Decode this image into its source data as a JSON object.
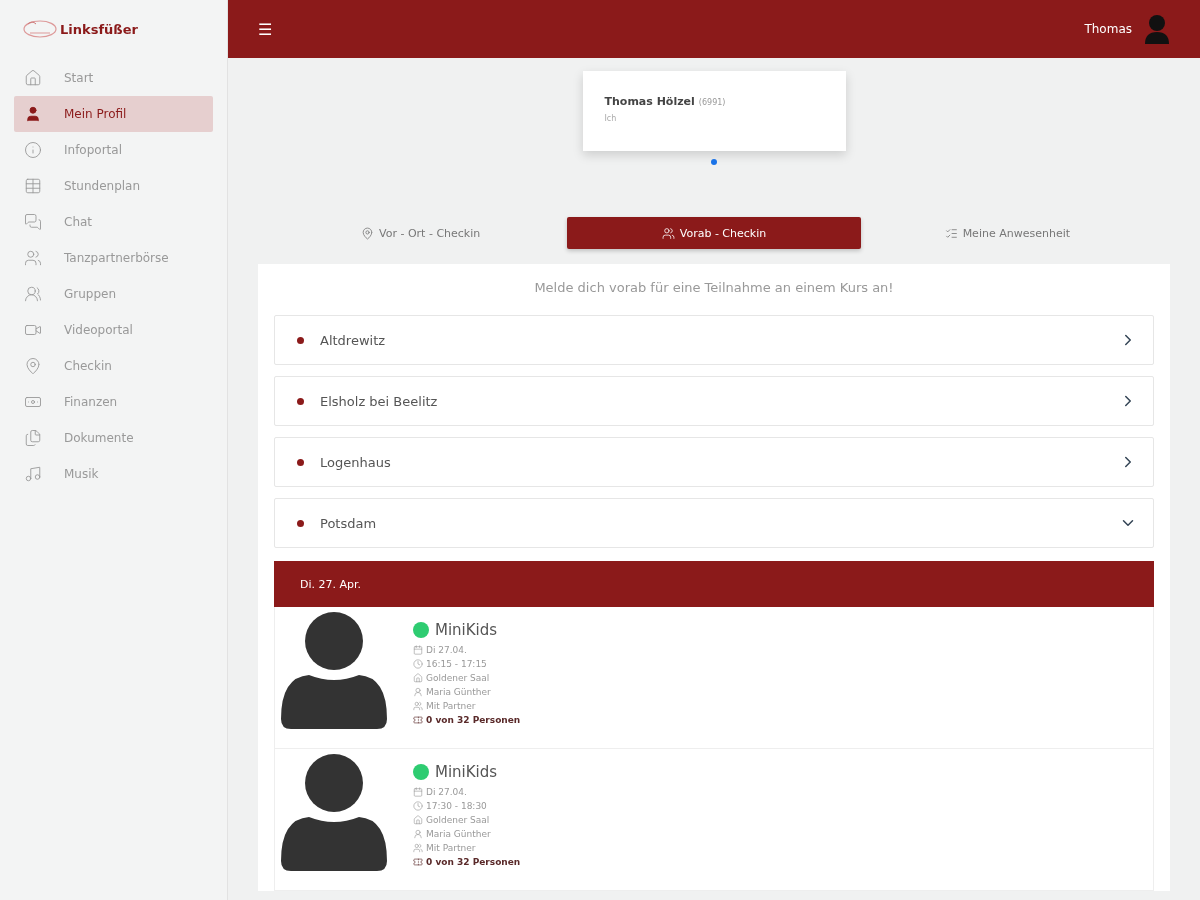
{
  "brand": {
    "name": "Linksfüßer"
  },
  "sidebar": {
    "items": [
      {
        "label": "Start",
        "selected": false
      },
      {
        "label": "Mein Profil",
        "selected": true
      },
      {
        "label": "Infoportal",
        "selected": false
      },
      {
        "label": "Stundenplan",
        "selected": false
      },
      {
        "label": "Chat",
        "selected": false
      },
      {
        "label": "Tanzpartnerbörse",
        "selected": false
      },
      {
        "label": "Gruppen",
        "selected": false
      },
      {
        "label": "Videoportal",
        "selected": false
      },
      {
        "label": "Checkin",
        "selected": false
      },
      {
        "label": "Finanzen",
        "selected": false
      },
      {
        "label": "Dokumente",
        "selected": false
      },
      {
        "label": "Musik",
        "selected": false
      }
    ]
  },
  "header": {
    "menu_glyph": "☰",
    "user_name": "Thomas"
  },
  "profile_card": {
    "name": "Thomas Hölzel",
    "id": "(6991)",
    "role": "Ich"
  },
  "tabs": [
    {
      "label": "Vor - Ort - Checkin",
      "selected": false
    },
    {
      "label": "Vorab - Checkin",
      "selected": true
    },
    {
      "label": "Meine Anwesenheit",
      "selected": false
    }
  ],
  "panel": {
    "intro": "Melde dich vorab für eine Teilnahme an einem Kurs an!",
    "locations": [
      {
        "name": "Altdrewitz",
        "expanded": false
      },
      {
        "name": "Elsholz bei Beelitz",
        "expanded": false
      },
      {
        "name": "Logenhaus",
        "expanded": false
      },
      {
        "name": "Potsdam",
        "expanded": true
      }
    ],
    "day_header": "Di. 27. Apr.",
    "courses": [
      {
        "title": "MiniKids",
        "color": "#2ecc71",
        "details": [
          {
            "kind": "date",
            "text": "Di 27.04."
          },
          {
            "kind": "time",
            "text": "16:15 - 17:15"
          },
          {
            "kind": "room",
            "text": "Goldener Saal"
          },
          {
            "kind": "teacher",
            "text": "Maria Günther"
          },
          {
            "kind": "partner",
            "text": "Mit Partner"
          },
          {
            "kind": "capacity",
            "text": "0 von 32 Personen"
          }
        ]
      },
      {
        "title": "MiniKids",
        "color": "#2ecc71",
        "details": [
          {
            "kind": "date",
            "text": "Di 27.04."
          },
          {
            "kind": "time",
            "text": "17:30 - 18:30"
          },
          {
            "kind": "room",
            "text": "Goldener Saal"
          },
          {
            "kind": "teacher",
            "text": "Maria Günther"
          },
          {
            "kind": "partner",
            "text": "Mit Partner"
          },
          {
            "kind": "capacity",
            "text": "0 von 32 Personen"
          }
        ]
      }
    ]
  }
}
